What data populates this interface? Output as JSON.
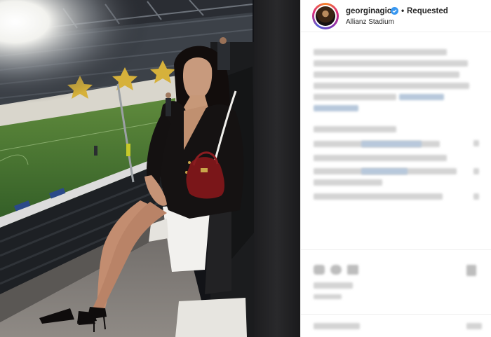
{
  "post": {
    "username": "georginagio",
    "follow_status": "Requested",
    "separator": "•",
    "location": "Allianz Stadium"
  },
  "icons": {
    "verified": "verified-badge-icon",
    "heart": "heart-icon",
    "comment": "comment-icon",
    "share": "share-icon",
    "bookmark": "bookmark-icon"
  },
  "colors": {
    "verified": "#3897f0",
    "text": "#262626",
    "blur_text": "#d4d4d4",
    "blur_link": "#b7c8db"
  }
}
